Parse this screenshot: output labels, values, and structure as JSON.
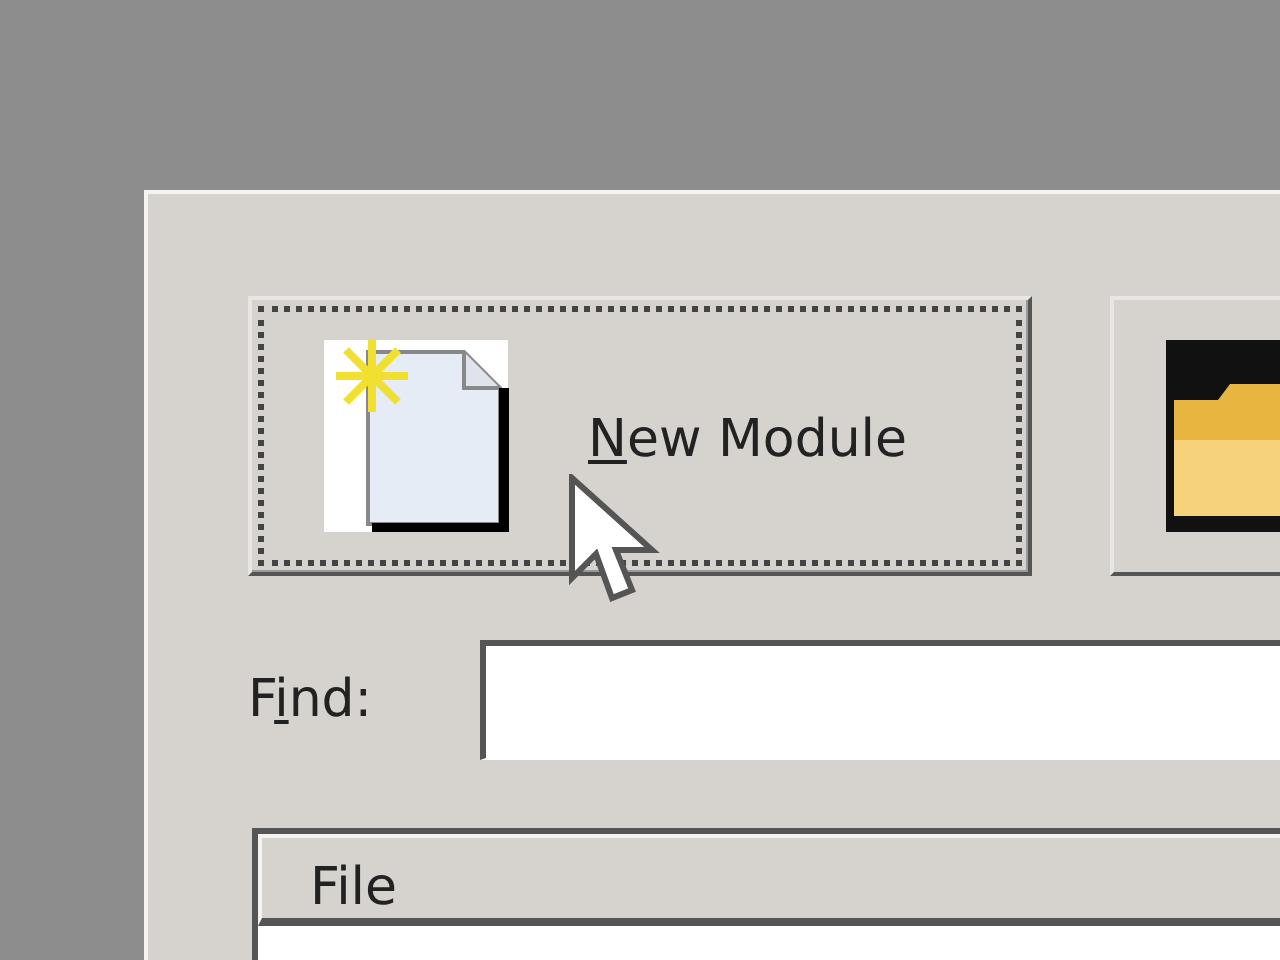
{
  "dialog": {
    "buttons": [
      {
        "kind": "new",
        "label_parts": [
          {
            "text": "N",
            "underlined": true
          },
          {
            "text": "ew Module",
            "underlined": false
          }
        ],
        "focused": true
      },
      {
        "kind": "open",
        "focused": false
      }
    ],
    "find": {
      "label_parts": [
        {
          "text": "F",
          "underlined": false
        },
        {
          "text": "i",
          "underlined": true
        },
        {
          "text": "nd:",
          "underlined": false
        }
      ]
    },
    "list": {
      "columns": [
        "File"
      ]
    }
  }
}
